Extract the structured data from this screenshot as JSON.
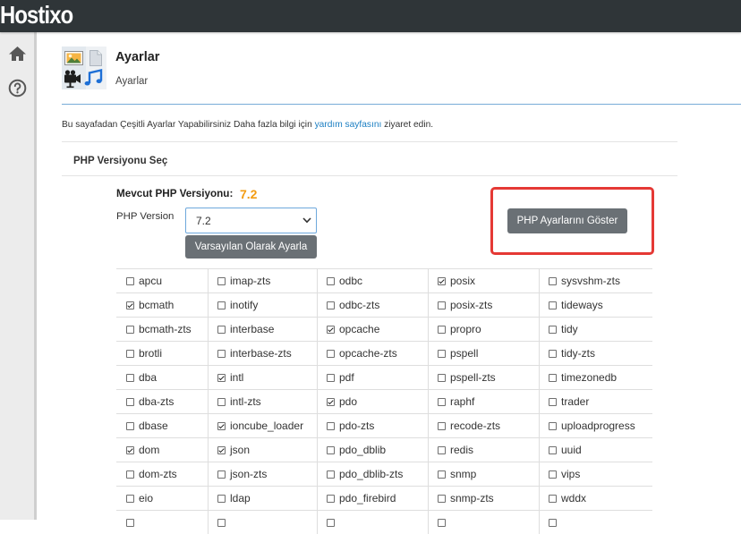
{
  "topbar": {
    "logo": "Hostixo"
  },
  "sidebar": {
    "items": [
      {
        "icon": "home-icon"
      },
      {
        "icon": "help-circle-icon"
      }
    ]
  },
  "header": {
    "icon": "media-settings-icon",
    "title": "Ayarlar",
    "subtitle": "Ayarlar"
  },
  "intro": {
    "text_before": "Bu sayafadan Çeşitli Ayarlar Yapabilirsiniz Daha fazla bilgi için ",
    "link": "yardım sayfasını",
    "text_after": " ziyaret edin."
  },
  "php_panel": {
    "title": "PHP Versiyonu Seç",
    "current_version_label": "Mevcut PHP Versiyonu:",
    "current_version": "7.2",
    "version_label": "PHP Version",
    "version_select": {
      "selected": "7.2"
    },
    "set_default_button": "Varsayılan Olarak Ayarla",
    "show_settings_button": "PHP Ayarlarını Göster"
  },
  "extensions": {
    "rows": [
      [
        {
          "name": "apcu",
          "checked": false
        },
        {
          "name": "imap-zts",
          "checked": false
        },
        {
          "name": "odbc",
          "checked": false
        },
        {
          "name": "posix",
          "checked": true
        },
        {
          "name": "sysvshm-zts",
          "checked": false
        }
      ],
      [
        {
          "name": "bcmath",
          "checked": true
        },
        {
          "name": "inotify",
          "checked": false
        },
        {
          "name": "odbc-zts",
          "checked": false
        },
        {
          "name": "posix-zts",
          "checked": false
        },
        {
          "name": "tideways",
          "checked": false
        }
      ],
      [
        {
          "name": "bcmath-zts",
          "checked": false
        },
        {
          "name": "interbase",
          "checked": false
        },
        {
          "name": "opcache",
          "checked": true
        },
        {
          "name": "propro",
          "checked": false
        },
        {
          "name": "tidy",
          "checked": false
        }
      ],
      [
        {
          "name": "brotli",
          "checked": false
        },
        {
          "name": "interbase-zts",
          "checked": false
        },
        {
          "name": "opcache-zts",
          "checked": false
        },
        {
          "name": "pspell",
          "checked": false
        },
        {
          "name": "tidy-zts",
          "checked": false
        }
      ],
      [
        {
          "name": "dba",
          "checked": false
        },
        {
          "name": "intl",
          "checked": true
        },
        {
          "name": "pdf",
          "checked": false
        },
        {
          "name": "pspell-zts",
          "checked": false
        },
        {
          "name": "timezonedb",
          "checked": false
        }
      ],
      [
        {
          "name": "dba-zts",
          "checked": false
        },
        {
          "name": "intl-zts",
          "checked": false
        },
        {
          "name": "pdo",
          "checked": true
        },
        {
          "name": "raphf",
          "checked": false
        },
        {
          "name": "trader",
          "checked": false
        }
      ],
      [
        {
          "name": "dbase",
          "checked": false
        },
        {
          "name": "ioncube_loader",
          "checked": true
        },
        {
          "name": "pdo-zts",
          "checked": false
        },
        {
          "name": "recode-zts",
          "checked": false
        },
        {
          "name": "uploadprogress",
          "checked": false
        }
      ],
      [
        {
          "name": "dom",
          "checked": true
        },
        {
          "name": "json",
          "checked": true
        },
        {
          "name": "pdo_dblib",
          "checked": false
        },
        {
          "name": "redis",
          "checked": false
        },
        {
          "name": "uuid",
          "checked": false
        }
      ],
      [
        {
          "name": "dom-zts",
          "checked": false
        },
        {
          "name": "json-zts",
          "checked": false
        },
        {
          "name": "pdo_dblib-zts",
          "checked": false
        },
        {
          "name": "snmp",
          "checked": false
        },
        {
          "name": "vips",
          "checked": false
        }
      ],
      [
        {
          "name": "eio",
          "checked": false
        },
        {
          "name": "ldap",
          "checked": false
        },
        {
          "name": "pdo_firebird",
          "checked": false
        },
        {
          "name": "snmp-zts",
          "checked": false
        },
        {
          "name": "wddx",
          "checked": false
        }
      ]
    ],
    "partial_row": [
      {
        "checked": false
      },
      {
        "checked": false
      },
      {
        "checked": false
      },
      {
        "checked": false
      },
      {
        "checked": false
      }
    ]
  },
  "colors": {
    "topbar": "#2f3538",
    "current_version": "#f39c12",
    "highlight_border": "#e53935",
    "button": "#6a7075",
    "link": "#1a7ec2"
  }
}
